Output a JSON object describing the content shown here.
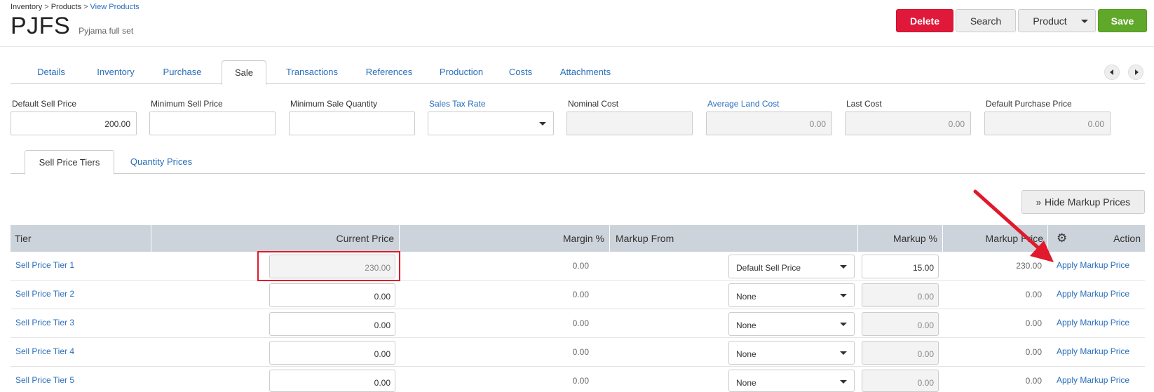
{
  "breadcrumb": {
    "item1": "Inventory",
    "sep": ">",
    "item2": "Products",
    "item3": "View Products"
  },
  "header": {
    "code": "PJFS",
    "name": "Pyjama full set"
  },
  "toolbar": {
    "delete": "Delete",
    "search": "Search",
    "product": "Product",
    "save": "Save"
  },
  "tabs": [
    "Details",
    "Inventory",
    "Purchase",
    "Sale",
    "Transactions",
    "References",
    "Production",
    "Costs",
    "Attachments"
  ],
  "active_tab": "Sale",
  "fields": {
    "default_sell_price": {
      "label": "Default Sell Price",
      "value": "200.00"
    },
    "minimum_sell_price": {
      "label": "Minimum Sell Price",
      "value": ""
    },
    "minimum_sale_quantity": {
      "label": "Minimum Sale Quantity",
      "value": ""
    },
    "sales_tax_rate": {
      "label": "Sales Tax Rate",
      "value": ""
    },
    "nominal_cost": {
      "label": "Nominal Cost",
      "value": ""
    },
    "average_land_cost": {
      "label": "Average Land Cost",
      "value": "0.00"
    },
    "last_cost": {
      "label": "Last Cost",
      "value": "0.00"
    },
    "default_purchase_price": {
      "label": "Default Purchase Price",
      "value": "0.00"
    }
  },
  "subtabs": [
    "Sell Price Tiers",
    "Quantity Prices"
  ],
  "hide_markup_label": "Hide Markup Prices",
  "table": {
    "headers": {
      "tier": "Tier",
      "current_price": "Current Price",
      "margin": "Margin %",
      "markup_from": "Markup From",
      "markup_pct": "Markup %",
      "markup_price": "Markup Price",
      "action": "Action"
    },
    "rows": [
      {
        "tier": "Sell Price Tier 1",
        "current_price": "230.00",
        "margin": "0.00",
        "markup_from": "Default Sell Price",
        "markup_pct": "15.00",
        "markup_price": "230.00",
        "action": "Apply Markup Price"
      },
      {
        "tier": "Sell Price Tier 2",
        "current_price": "0.00",
        "margin": "0.00",
        "markup_from": "None",
        "markup_pct": "0.00",
        "markup_price": "0.00",
        "action": "Apply Markup Price"
      },
      {
        "tier": "Sell Price Tier 3",
        "current_price": "0.00",
        "margin": "0.00",
        "markup_from": "None",
        "markup_pct": "0.00",
        "markup_price": "0.00",
        "action": "Apply Markup Price"
      },
      {
        "tier": "Sell Price Tier 4",
        "current_price": "0.00",
        "margin": "0.00",
        "markup_from": "None",
        "markup_pct": "0.00",
        "markup_price": "0.00",
        "action": "Apply Markup Price"
      },
      {
        "tier": "Sell Price Tier 5",
        "current_price": "0.00",
        "margin": "0.00",
        "markup_from": "None",
        "markup_pct": "0.00",
        "markup_price": "0.00",
        "action": "Apply Markup Price"
      }
    ]
  },
  "colors": {
    "delete": "#e0193a",
    "save": "#5fa82a",
    "link": "#2a6ebb",
    "table_header": "#ccd3da",
    "annotation": "#e0192c"
  }
}
